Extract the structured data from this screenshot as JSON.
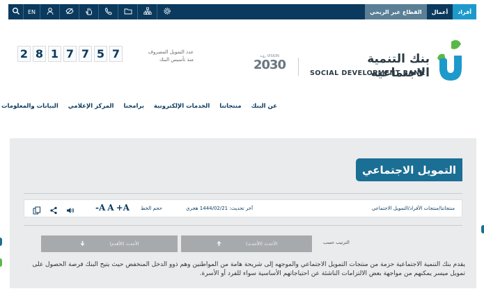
{
  "topbar": {
    "tabs": {
      "individuals": "أفراد",
      "business": "أعمال",
      "nonprofit": "القطاع غير الربحي"
    },
    "lang": "EN",
    "icons": [
      "search-icon",
      "user-icon",
      "eye-off-icon",
      "hand-icon",
      "phone-icon",
      "folder-icon",
      "sitemap-icon",
      "gear-icon"
    ]
  },
  "counter": {
    "digits": [
      "2",
      "8",
      "1",
      "7",
      "7",
      "5",
      "7"
    ],
    "label_line1": "عدد التمويل المصروف",
    "label_line2": "منذ تأسيس البنك"
  },
  "brand": {
    "vision_small": "رؤية VISION",
    "vision_year": "2030",
    "name_ar": "بنك التنمية الاجتماعية",
    "name_en": "SOCIAL DEVELOPMENT BANK",
    "colors": {
      "navy": "#0b3a5e",
      "teal": "#1b6e94",
      "green": "#5ab848",
      "blue": "#1d9acb"
    }
  },
  "nav": {
    "items": [
      "عن البنك",
      "منتجاتنا",
      "الخدمات الإلكترونية",
      "برامجنا",
      "المركز الإعلامي",
      "البيانات والمعلومات"
    ]
  },
  "page": {
    "title": "التمويل الاجتماعي",
    "breadcrumb": "منتجاتنا/منتجات الأفراد/التمويل الاجتماعي",
    "updated": "آخر تحديث: 1444/02/21 هجري",
    "font_size_label": "حجم الخط",
    "font_buttons": [
      "-A",
      "A",
      "+A"
    ],
    "tool_icons": [
      "speaker-icon",
      "share-icon",
      "copy-icon"
    ],
    "sort_label": "الترتيب حسب",
    "sort_newest": "الأحدث (الأحدث)",
    "sort_oldest": "الأحدث (الأقدم)",
    "description": "يقدم بنك التنمية الاجتماعية حزمة من منتجات التمويل الاجتماعي والموجهه إلى شريحة هامة من المواطنين وهم ذوو الدخل المنخفض حيث يتيح البنك فرصة الحصول على تمويل ميسر يمكنهم من مواجهة بعض الالتزامات الناشئة عن احتياجاتهم الأساسية سواء للفرد أو الأسرة."
  }
}
